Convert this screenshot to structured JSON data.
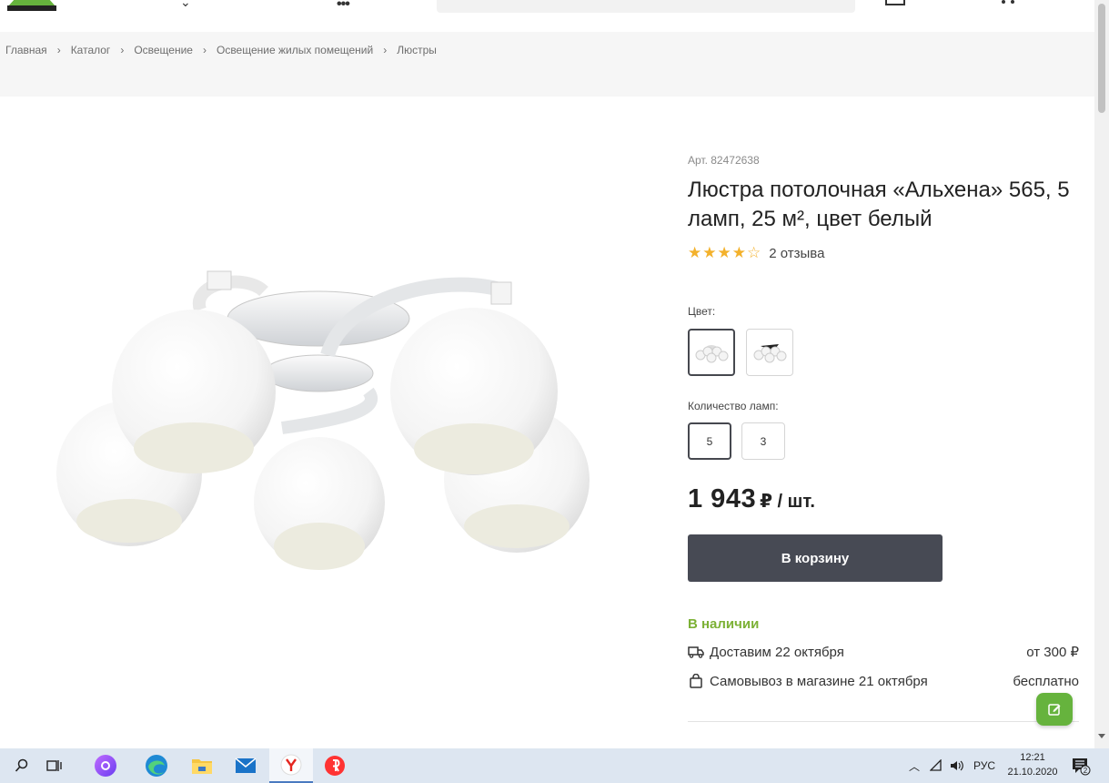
{
  "breadcrumb": [
    "Главная",
    "Каталог",
    "Освещение",
    "Освещение жилых помещений",
    "Люстры"
  ],
  "product": {
    "article": "Арт. 82472638",
    "title": "Люстра потолочная «Альхена» 565, 5 ламп, 25 м², цвет белый",
    "rating": 4,
    "rating_max": 5,
    "reviews": "2 отзыва",
    "color_label": "Цвет:",
    "lamps_label": "Количество ламп:",
    "lamp_options": [
      "5",
      "3"
    ],
    "lamp_selected": "5",
    "price": "1 943",
    "price_unit": "₽ / шт.",
    "cart_button": "В корзину",
    "stock": "В наличии",
    "delivery_text": "Доставим 22 октября",
    "delivery_price": "от 300 ₽",
    "pickup_text": "Самовывоз в магазине 21 октября",
    "pickup_price": "бесплатно"
  },
  "taskbar": {
    "lang": "РУС",
    "time": "12:21",
    "date": "21.10.2020",
    "notifications": "2"
  },
  "colors": {
    "accent_green": "#7cb135",
    "button_dark": "#474a54",
    "star": "#f3b12b"
  }
}
